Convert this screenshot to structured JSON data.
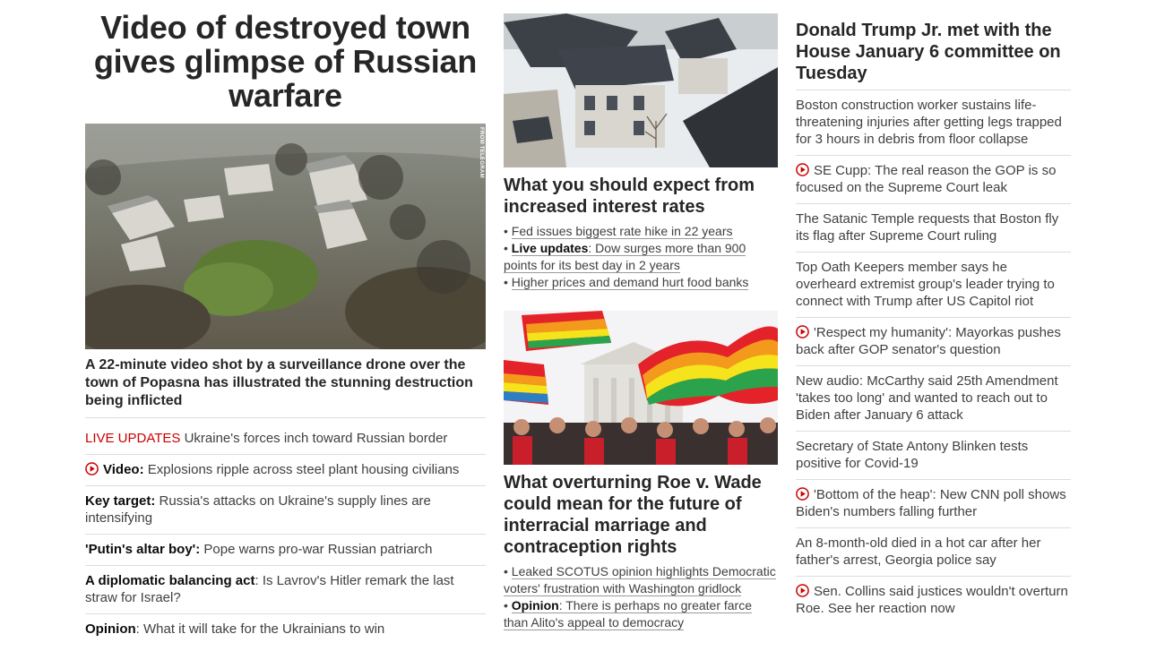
{
  "left": {
    "headline": "Video of destroyed town gives glimpse of Russian warfare",
    "image_credit": "FROM TELEGRAM",
    "lede": "A 22-minute video shot by a surveillance drone over the town of Popasna has illustrated the stunning destruction being inflicted",
    "items": [
      {
        "prefix": "LIVE UPDATES",
        "text": " Ukraine's forces inch toward Russian border"
      },
      {
        "prefix": "Video:",
        "text": " Explosions ripple across steel plant housing civilians"
      },
      {
        "prefix": "Key target:",
        "text": " Russia's attacks on Ukraine's supply lines are intensifying"
      },
      {
        "prefix": "'Putin's altar boy':",
        "text": " Pope warns pro-war Russian patriarch"
      },
      {
        "prefix": "A diplomatic balancing act",
        "text": ": Is Lavrov's Hitler remark the last straw for Israel?"
      },
      {
        "prefix": "Opinion",
        "text": ": What it will take for the Ukrainians to win"
      }
    ]
  },
  "middle": {
    "story1": {
      "title": "What you should expect from increased interest rates",
      "b1": "Fed issues biggest rate hike in 22 years",
      "b2_bold": "Live updates",
      "b2_text": ": Dow surges more than 900 points for its best day in 2 years",
      "b3": "Higher prices and demand hurt food banks"
    },
    "story2": {
      "title": "What overturning Roe v. Wade could mean for the future of interracial marriage and contraception rights",
      "b1": "Leaked SCOTUS opinion highlights Democratic voters' frustration with Washington gridlock",
      "b2_bold": "Opinion",
      "b2_text": ": There is perhaps no greater farce than Alito's appeal to democracy"
    },
    "bullet_char": "•"
  },
  "right": {
    "title": "Donald Trump Jr. met with the House January 6 committee on Tuesday",
    "items": [
      "Boston construction worker sustains life-threatening injuries after getting legs trapped for 3 hours in debris from floor collapse",
      "SE Cupp: The real reason the GOP is so focused on the Supreme Court leak",
      "The Satanic Temple requests that Boston fly its flag after Supreme Court ruling",
      "Top Oath Keepers member says he overheard extremist group's leader trying to connect with Trump after US Capitol riot",
      "'Respect my humanity': Mayorkas pushes back after GOP senator's question",
      "New audio: McCarthy said 25th Amendment 'takes too long' and wanted to reach out to Biden after January 6 attack",
      "Secretary of State Antony Blinken tests positive for Covid-19",
      "'Bottom of the heap': New CNN poll shows Biden's numbers falling further",
      "An 8-month-old died in a hot car after her father's arrest, Georgia police say",
      "Sen. Collins said justices wouldn't overturn Roe. See her reaction now"
    ]
  },
  "colors": {
    "accent_red": "#cc0000",
    "text": "#262626",
    "divider": "#dddddd"
  }
}
